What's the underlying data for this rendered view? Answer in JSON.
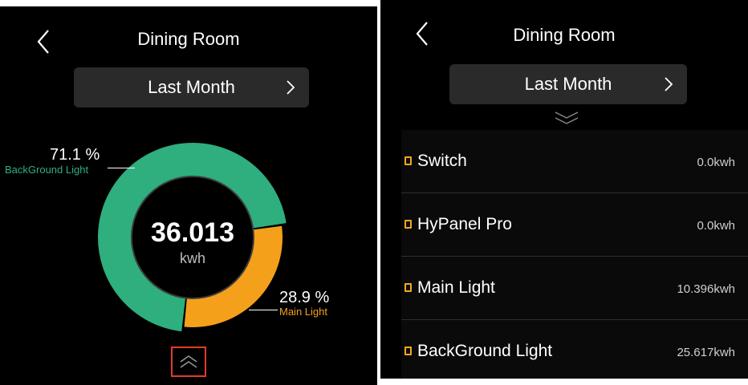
{
  "colors": {
    "background": "#000000",
    "primary_slice": "#2fae7e",
    "secondary_slice": "#f5a01a",
    "expand_highlight": "#e53a2a"
  },
  "left": {
    "title": "Dining Room",
    "period_label": "Last Month",
    "total_value": "36.013",
    "total_unit": "kwh",
    "icons": {
      "back": "chevron-left-icon",
      "next": "chevron-right-icon",
      "expand": "double-chevron-up-icon"
    }
  },
  "chart_data": {
    "type": "pie",
    "categories": [
      "BackGround Light",
      "Main Light"
    ],
    "values": [
      71.1,
      28.9
    ],
    "labels": [
      "71.1 %",
      "28.9 %"
    ]
  },
  "right": {
    "title": "Dining Room",
    "period_label": "Last Month",
    "icons": {
      "back": "chevron-left-icon",
      "next": "chevron-right-icon",
      "collapse": "double-chevron-down-icon",
      "device": "device-icon"
    },
    "items": [
      {
        "name": "Switch",
        "value": "0.0kwh"
      },
      {
        "name": "HyPanel Pro",
        "value": "0.0kwh"
      },
      {
        "name": "Main Light",
        "value": "10.396kwh"
      },
      {
        "name": "BackGround Light",
        "value": "25.617kwh"
      }
    ]
  }
}
